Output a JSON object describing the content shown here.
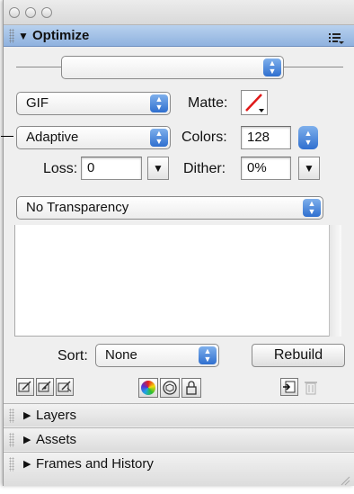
{
  "panel": {
    "title": "Optimize",
    "settings_popup": {
      "value": ""
    },
    "format": {
      "value": "GIF"
    },
    "matte_label": "Matte:",
    "palette": {
      "value": "Adaptive"
    },
    "colors_label": "Colors:",
    "colors_value": "128",
    "loss_label": "Loss:",
    "loss_value": "0",
    "dither_label": "Dither:",
    "dither_value": "0%",
    "transparency": {
      "value": "No Transparency"
    },
    "sort_label": "Sort:",
    "sort_value": "None",
    "rebuild_label": "Rebuild"
  },
  "collapsed_panels": [
    {
      "label": "Layers"
    },
    {
      "label": "Assets"
    },
    {
      "label": "Frames and History"
    }
  ],
  "icons": [
    "traffic-light-close-icon",
    "traffic-light-minimize-icon",
    "traffic-light-zoom-icon",
    "panel-options-menu-icon",
    "matte-swatch-icon",
    "edit-color-icon",
    "snap-to-web-safe-icon",
    "add-color-icon",
    "color-wheel-icon",
    "cube-icon",
    "lock-icon",
    "add-new-color-icon",
    "trash-icon"
  ],
  "colors": {
    "header_blue": "#9bbbe6",
    "popup_arrow_blue": "#2f6fcf",
    "window_bg": "#efefef"
  }
}
